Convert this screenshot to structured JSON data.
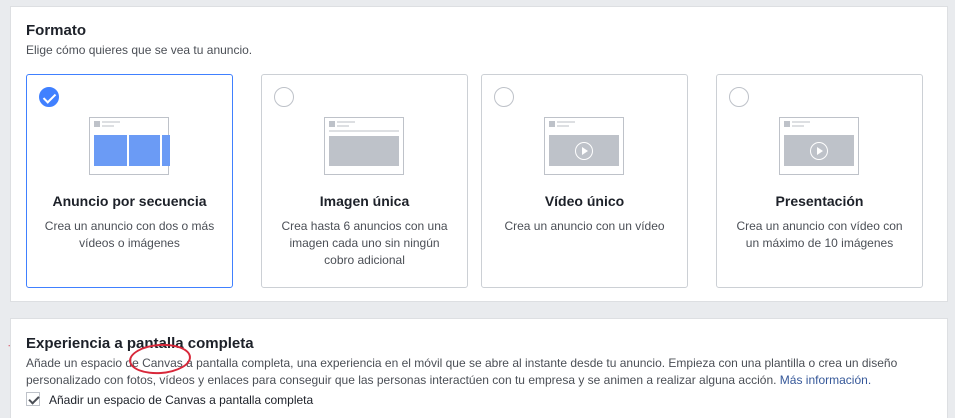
{
  "format": {
    "title": "Formato",
    "subtitle": "Elige cómo quieres que se vea tu anuncio.",
    "options": [
      {
        "title": "Anuncio por secuencia",
        "desc": "Crea un anuncio con dos o más vídeos o imágenes",
        "selected": true
      },
      {
        "title": "Imagen única",
        "desc": "Crea hasta 6 anuncios con una imagen cada uno sin ningún cobro adicional",
        "selected": false
      },
      {
        "title": "Vídeo único",
        "desc": "Crea un anuncio con un vídeo",
        "selected": false
      },
      {
        "title": "Presentación",
        "desc": "Crea un anuncio con vídeo con un máximo de 10 imágenes",
        "selected": false
      }
    ]
  },
  "fullscreen": {
    "title": "Experiencia a pantalla completa",
    "text_before": "Añade un espacio de ",
    "highlight": "Canvas",
    "text_after": " a pantalla completa, una experiencia en el móvil que se abre al instante desde tu anuncio. Empieza con una plantilla o crea un diseño personalizado con fotos, vídeos y enlaces para conseguir que las personas interactúen con tu empresa y se animen a realizar alguna acción. ",
    "link": "Más información.",
    "checkbox_label": "Añadir un espacio de Canvas a pantalla completa",
    "checkbox_checked": true
  },
  "annotation": {
    "arrow": "→",
    "color": "#d0021b"
  }
}
